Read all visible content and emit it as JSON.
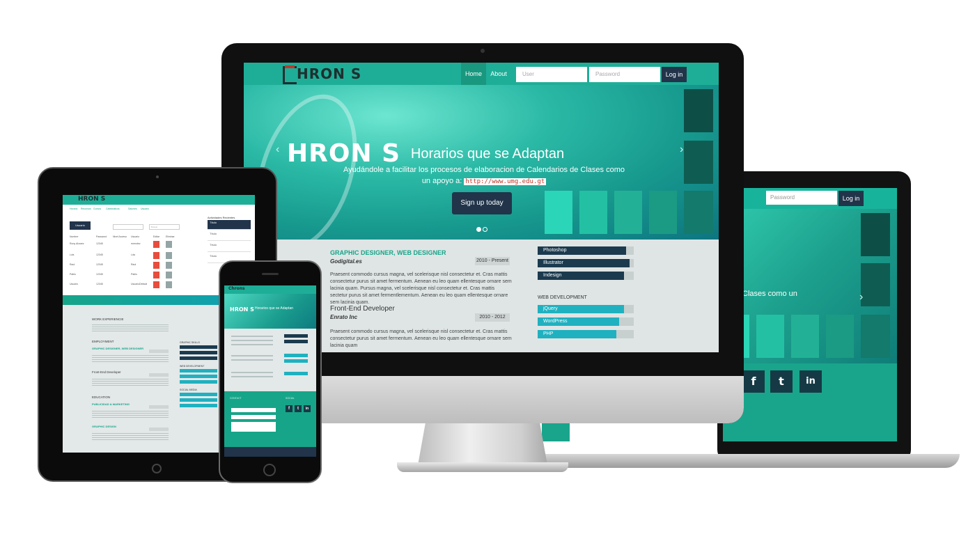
{
  "brand": {
    "logo_text": "HRON S",
    "hero_logo_text": "HRON S"
  },
  "nav": {
    "items": [
      "Home",
      "About"
    ],
    "user_placeholder": "User",
    "password_placeholder": "Password",
    "login_label": "Log in"
  },
  "hero": {
    "title": "Horarios que se Adaptan",
    "subtitle": "Ayudándole a facilitar los procesos de elaboracion de Calendarios de Clases como un apoyo a:",
    "url": "http://www.umg.edu.gt",
    "cta": "Sign up today",
    "prev_arrow": "‹",
    "next_arrow": "›"
  },
  "experience": [
    {
      "title": "GRAPHIC DESIGNER, WEB DESIGNER",
      "company": "Godigital.es",
      "period": "2010 - Present",
      "text": "Praesent commodo cursus magna, vel scelerisque nisl consectetur et. Cras mattis consectetur purus sit amet fermentum. Aenean eu leo quam ellentesque ornare sem lacinia quam. Pursus magna, vel scelerisque nisl consectetur et. Cras mattis sectetur purus sit amet fermentlementum. Aenean eu leo quam ellentesque ornare sem lacinia quam."
    },
    {
      "title": "Front-End Developer",
      "company": "Enrato Inc",
      "period": "2010 - 2012",
      "text": "Praesent commodo cursus magna, vel scelerisque nisl consectetur et. Cras mattis consectetur purus sit amet fermentum. Aenean eu leo quam ellentesque ornare sem lacinia quam"
    }
  ],
  "skills": {
    "graphic": [
      {
        "name": "Photoshop",
        "level": 0.92
      },
      {
        "name": "Illustrator",
        "level": 0.96
      },
      {
        "name": "Indesign",
        "level": 0.9
      }
    ],
    "web_heading": "WEB DEVELOPMENT",
    "web": [
      {
        "name": "jQuery",
        "level": 0.9
      },
      {
        "name": "WordPress",
        "level": 0.85
      },
      {
        "name": "PHP",
        "level": 0.82
      }
    ]
  },
  "laptop": {
    "password_placeholder": "Password",
    "login_label": "Log in",
    "text": "Clases como un",
    "social": [
      "f",
      "t",
      "in"
    ]
  },
  "tablet": {
    "nav_links": [
      "Horario",
      "Recursos",
      "Cursos",
      "Catedraticos",
      "Salones",
      "Usuario"
    ],
    "new_button": "Usuario",
    "search_placeholder": "Buscar",
    "columns": [
      "Nombre",
      "Password",
      "Nivel Acceso",
      "Usuario",
      "Editar",
      "Eliminar"
    ],
    "rows": [
      [
        "Rony Alvarez",
        "12345",
        "1",
        "rmendez"
      ],
      [
        "Luis",
        "12345",
        "1",
        "Lda"
      ],
      [
        "Raul",
        "12345",
        "1",
        "Raul"
      ],
      [
        "Pablo",
        "12345",
        "1",
        "Pablo"
      ],
      [
        "Usuario",
        "12345",
        "1",
        "UsuarioDefault"
      ]
    ],
    "side_heading": "Actividades Recientes",
    "side_items": [
      "Título",
      "Título",
      "Título",
      "Título"
    ],
    "work_heading": "WORK EXPERIENCIE",
    "employment_heading": "EMPLOYMENT",
    "education_heading": "EDUCATION",
    "job1": "GRAPHIC DESIGNER, WEB DESIGNER",
    "job2": "Front-End Developer",
    "edu1": "PUBLICIDAD & MARKETING",
    "edu2": "GRAPHIC DESIGN",
    "skills_heading": "GRAPHIC SKILLS",
    "web_heading": "WEB DEVELOPMENT",
    "social_heading": "SOCIAL MEDIA"
  },
  "phone": {
    "logo_text": "Chrons",
    "hero_title": "Horarios que se Adaptan",
    "contact_heading": "CONTACT",
    "social_heading": "SOCIAL"
  },
  "colors": {
    "accent": "#1eae98",
    "dark": "#21344a",
    "teal_dark": "#0d4f47"
  }
}
